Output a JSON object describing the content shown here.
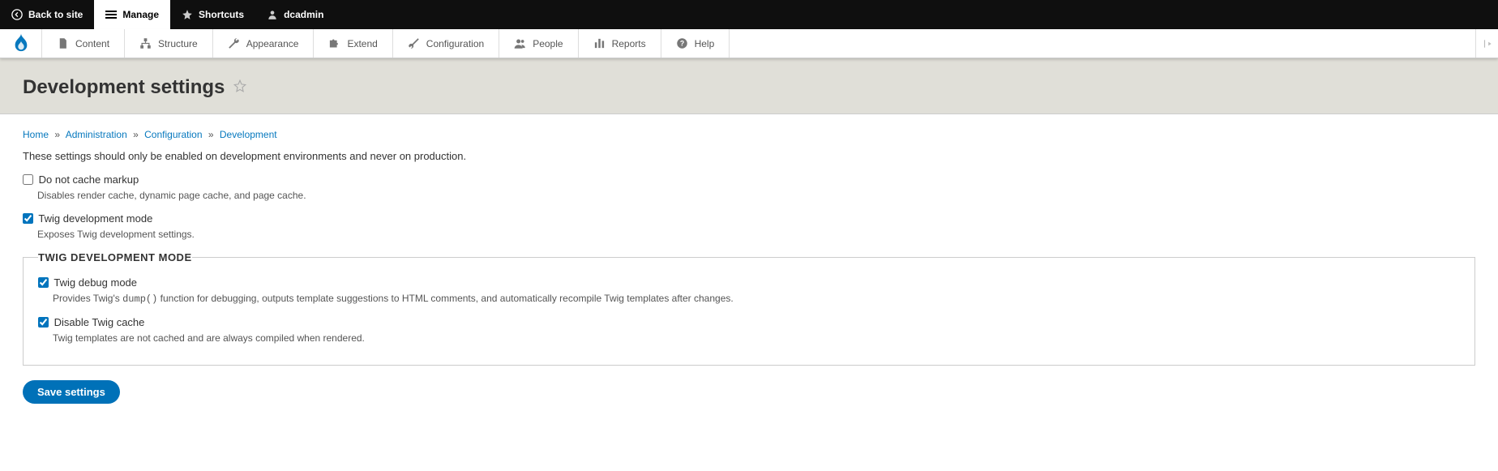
{
  "toolbar": {
    "back": "Back to site",
    "manage": "Manage",
    "shortcuts": "Shortcuts",
    "user": "dcadmin"
  },
  "adminmenu": {
    "content": "Content",
    "structure": "Structure",
    "appearance": "Appearance",
    "extend": "Extend",
    "configuration": "Configuration",
    "people": "People",
    "reports": "Reports",
    "help": "Help"
  },
  "page": {
    "title": "Development settings"
  },
  "breadcrumb": {
    "home": "Home",
    "admin": "Administration",
    "config": "Configuration",
    "dev": "Development"
  },
  "intro": "These settings should only be enabled on development environments and never on production.",
  "form": {
    "no_cache": {
      "label": "Do not cache markup",
      "desc": "Disables render cache, dynamic page cache, and page cache."
    },
    "twig_dev": {
      "label": "Twig development mode",
      "desc": "Exposes Twig development settings."
    },
    "fieldset_legend": "Twig development mode",
    "twig_debug": {
      "label": "Twig debug mode",
      "desc_pre": "Provides Twig's ",
      "desc_code": "dump()",
      "desc_post": " function for debugging, outputs template suggestions to HTML comments, and automatically recompile Twig templates after changes."
    },
    "disable_cache": {
      "label": "Disable Twig cache",
      "desc": "Twig templates are not cached and are always compiled when rendered."
    },
    "submit": "Save settings"
  }
}
